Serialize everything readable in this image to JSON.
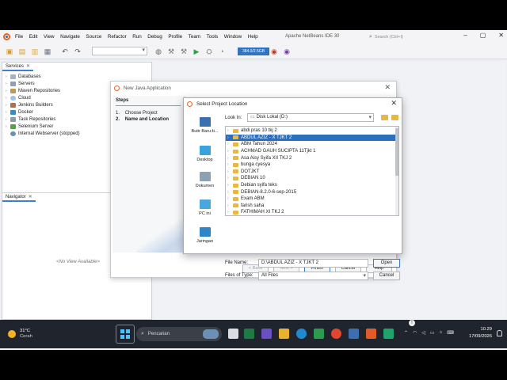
{
  "ide": {
    "title": "Apache NetBeans IDE 30",
    "search_placeholder": "Search (Ctrl+I)",
    "menu": [
      "File",
      "Edit",
      "View",
      "Navigate",
      "Source",
      "Refactor",
      "Run",
      "Debug",
      "Profile",
      "Team",
      "Tools",
      "Window",
      "Help"
    ],
    "memory": "384.0/2.5GB"
  },
  "services": {
    "tab": "Services",
    "items": [
      "Databases",
      "Servers",
      "Maven Repositories",
      "Cloud",
      "Jenkins Builders",
      "Docker",
      "Task Repositories",
      "Selenium Server",
      "Internal Webserver (stopped)"
    ]
  },
  "navigator": {
    "tab": "Navigator",
    "empty": "<No View Available>"
  },
  "wizard": {
    "title": "New Java Application",
    "steps_header": "Steps",
    "steps": [
      {
        "num": "1.",
        "label": "Choose Project"
      },
      {
        "num": "2.",
        "label": "Name and Location"
      }
    ],
    "buttons": {
      "back": "< Back",
      "next": "Next >",
      "finish": "Finish",
      "cancel": "Cancel",
      "help": "Help"
    }
  },
  "dialog": {
    "title": "Select Project Location",
    "look_in_label": "Look In:",
    "look_in_value": "Disk Lokal (D:)",
    "places": [
      "Butir Baru-b...",
      "Desktop",
      "Dokumen",
      "PC ini",
      "Jaringan"
    ],
    "files": [
      "abdi pras 10 tkj 2",
      "ABDUL AZIZ - X TJKT 2",
      "ABM Tahun 2024",
      "ACHMAD GAUH SUCIPTA 11Tjkt 1",
      "Asa Aisy Syifa XII TKJ 2",
      "bunga cyesya",
      "DOTJKT",
      "DEBIAN 10",
      "Debian syifa teks",
      "DEBIAN-8.2.0-6-sep-2015",
      "Exam ABM",
      "farish saha",
      "FATHIMAH XI TKJ 2",
      "febi",
      "Ilham Fathi & Farrasyah XII TKJ 2"
    ],
    "selected_index": 1,
    "file_name_label": "File Name:",
    "file_name_value": "D:\\ABDUL AZIZ - X TJKT 2",
    "file_type_label": "Files of Type:",
    "file_type_value": "All Files",
    "open": "Open",
    "cancel": "Cancel"
  },
  "taskbar": {
    "temp": "31°C",
    "condition": "Cerah",
    "search": "Pencarian",
    "time": "10.29",
    "date": "17/09/2026"
  }
}
